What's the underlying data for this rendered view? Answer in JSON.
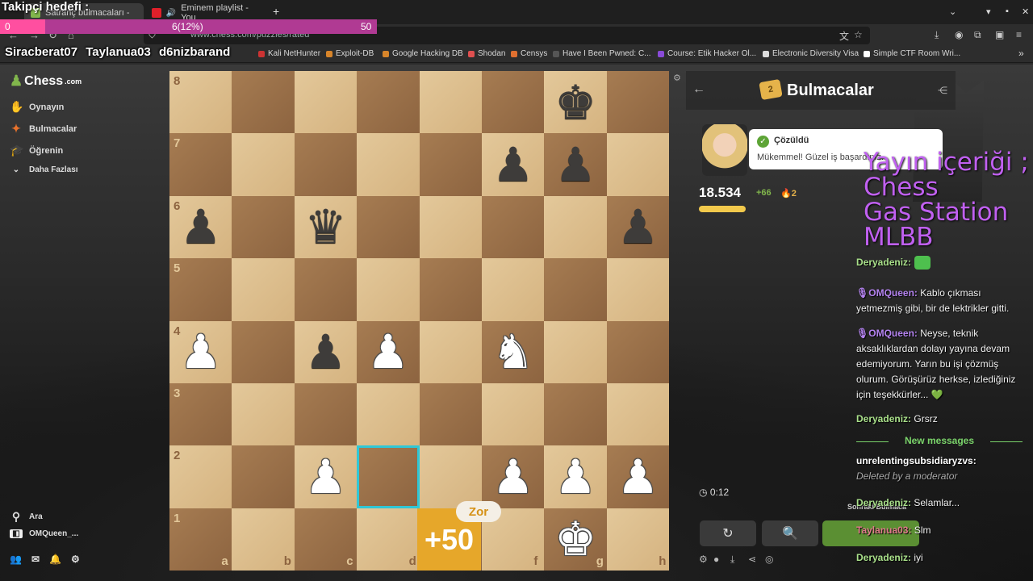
{
  "tabs": [
    {
      "label": "Satranç bulmacaları -",
      "active": true
    },
    {
      "label": "Eminem playlist - You",
      "active": false
    }
  ],
  "url": "www.chess.com/puzzles/rated",
  "bookmarks": [
    "Kali NetHunter",
    "Exploit-DB",
    "Google Hacking DB",
    "Shodan",
    "Censys",
    "Have I Been Pwned: C...",
    "Course: Etik Hacker Ol...",
    "Electronic Diversity Visa",
    "Simple CTF Room Wri..."
  ],
  "follower_goal": {
    "title": "Takipçi hedefi :",
    "current": "0",
    "progress_text": "6(12%)",
    "goal": "50",
    "fill_percent": 12
  },
  "subscribers": "Siracberat07 Taylanua03 d6nizbarand",
  "sidebar": {
    "logo_text": "Chess",
    "logo_suffix": ".com",
    "items": [
      {
        "label": "Oynayın",
        "icon": "play-hand-icon"
      },
      {
        "label": "Bulmacalar",
        "icon": "puzzle-icon"
      },
      {
        "label": "Öğrenin",
        "icon": "learn-cap-icon"
      },
      {
        "label": "Daha Fazlası",
        "icon": "chevron-down-icon"
      }
    ],
    "search_label": "Ara",
    "user_label": "OMQueen_..."
  },
  "board": {
    "files": [
      "a",
      "b",
      "c",
      "d",
      "e",
      "f",
      "g",
      "h"
    ],
    "ranks": [
      "8",
      "7",
      "6",
      "5",
      "4",
      "3",
      "2",
      "1"
    ],
    "pieces": [
      {
        "sq": "g8",
        "glyph": "♚",
        "color": "b"
      },
      {
        "sq": "f7",
        "glyph": "♟",
        "color": "b"
      },
      {
        "sq": "g7",
        "glyph": "♟",
        "color": "b"
      },
      {
        "sq": "a6",
        "glyph": "♟",
        "color": "b"
      },
      {
        "sq": "c6",
        "glyph": "♛",
        "color": "b"
      },
      {
        "sq": "h6",
        "glyph": "♟",
        "color": "b"
      },
      {
        "sq": "a4",
        "glyph": "♟",
        "color": "w"
      },
      {
        "sq": "c4",
        "glyph": "♟",
        "color": "b"
      },
      {
        "sq": "d4",
        "glyph": "♟",
        "color": "w"
      },
      {
        "sq": "f4",
        "glyph": "♞",
        "color": "w"
      },
      {
        "sq": "c2",
        "glyph": "♟",
        "color": "w"
      },
      {
        "sq": "f2",
        "glyph": "♟",
        "color": "w"
      },
      {
        "sq": "g2",
        "glyph": "♟",
        "color": "w"
      },
      {
        "sq": "h2",
        "glyph": "♟",
        "color": "w"
      },
      {
        "sq": "g1",
        "glyph": "♚",
        "color": "w"
      }
    ],
    "highlight_square": "d2",
    "bonus_text": "+50",
    "difficulty": "Zor"
  },
  "panel": {
    "title": "Bulmacalar",
    "puzzle_badge": "2",
    "coach_status": "Çözüldü",
    "coach_message": "Mükemmel! Güzel iş başardınız.",
    "rating": "18.534",
    "rating_delta": "+66",
    "streak": "2",
    "timer": "0:12",
    "next_label": "Sonraki Bulmaca"
  },
  "stream_topics": "Yayın içeriği ;\nChess\nGas Station\nMLBB",
  "chat": [
    {
      "user": "Deryadeniz:",
      "text": "",
      "style": "g",
      "emoji": true
    },
    {
      "user": "OMQueen:",
      "text": " Kablo çıkması yetmezmiş gibi, bir de lektrikler gitti.",
      "style": "p"
    },
    {
      "user": "OMQueen:",
      "text": " Neyse, teknik aksaklıklardan dolayı yayına devam edemiyorum. Yarın bu işi çözmüş olurum. Görüşürüz herkse, izlediğiniz için teşekkürler... 💚",
      "style": "p"
    },
    {
      "user": "Deryadeniz:",
      "text": " Grsrz",
      "style": "g"
    },
    {
      "user": "unrelentingsubsidiaryzvs:",
      "text": "Deleted by a moderator",
      "style": "w",
      "deleted": true
    },
    {
      "user": "Deryadeniz:",
      "text": " Selamlar...",
      "style": "g"
    },
    {
      "user": "Taylanua03:",
      "text": " Slm",
      "style": "r"
    },
    {
      "user": "Deryadeniz:",
      "text": " iyi",
      "style": "g"
    }
  ],
  "new_messages_label": "New messages"
}
